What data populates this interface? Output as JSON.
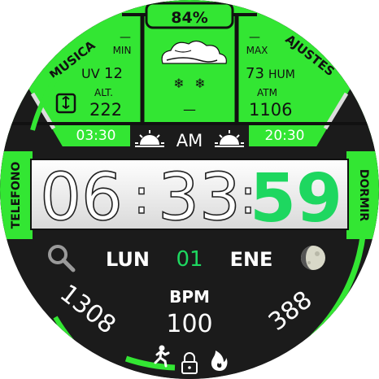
{
  "battery": {
    "percent_label": "84%"
  },
  "left_panel": {
    "min_dash": "—",
    "min_label": "MIN",
    "uv_label": "UV",
    "uv_value": "12",
    "alt_label": "ALT.",
    "alt_value": "222",
    "sunrise_time": "03:30"
  },
  "right_panel": {
    "max_dash": "—",
    "max_label": "MAX",
    "hum_value": "73",
    "hum_label": "HUM",
    "atm_label": "ATM",
    "atm_value": "1106",
    "sunset_time": "20:30"
  },
  "center_panel": {
    "temp_value": "—",
    "weather_icon": "snow-cloud-icon"
  },
  "shortcuts": {
    "music": "MUSICA",
    "settings": "AJUSTES",
    "phone": "TELEFONO",
    "sleep": "DORMIR"
  },
  "time": {
    "ampm": "AM",
    "hours": "06",
    "minutes": "33",
    "seconds": "59",
    "sep1": ":",
    "sep2": ":"
  },
  "date": {
    "weekday": "LUN",
    "day": "01",
    "month": "ENE"
  },
  "stats": {
    "steps": "1308",
    "calories": "388",
    "bpm_label": "BPM",
    "bpm_value": "100"
  },
  "colors": {
    "accent": "#33e633",
    "accent_dark": "#1fa51f",
    "seconds": "#1ed760",
    "bg": "#1b1b1b",
    "band": "#f2f2f2"
  }
}
